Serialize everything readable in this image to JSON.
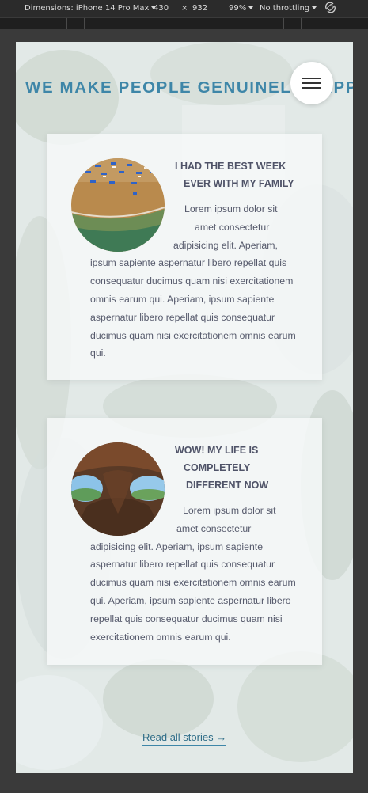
{
  "devtools": {
    "dimensions_label": "Dimensions: iPhone 14 Pro Max",
    "width": "430",
    "times": "×",
    "height": "932",
    "zoom": "99%",
    "throttling": "No throttling",
    "rotate_icon": "rotate-icon"
  },
  "page": {
    "headline": "WE MAKE PEOPLE GENUINELY HAPPY",
    "menu_icon": "hamburger-menu-icon"
  },
  "stories": [
    {
      "title_lines": [
        "I HAD THE BEST WEEK",
        "EVER WITH MY FAMILY"
      ],
      "body_lines": [
        "Lorem ipsum dolor sit",
        "amet consectetur",
        "adipisicing elit. Aperiam,",
        "ipsum sapiente aspernatur libero repellat quis",
        "consequatur ducimus quam nisi exercitationem",
        "omnis earum qui. Aperiam, ipsum sapiente",
        "aspernatur libero repellat quis consequatur",
        "ducimus quam nisi exercitationem omnis earum",
        "qui."
      ],
      "image": "beach-aerial-photo"
    },
    {
      "title_lines": [
        "WOW! MY LIFE IS",
        "COMPLETELY",
        "DIFFERENT NOW"
      ],
      "body_lines": [
        "Lorem ipsum dolor sit",
        "amet consectetur",
        "adipisicing elit. Aperiam, ipsum sapiente",
        "aspernatur libero repellat quis consequatur",
        "ducimus quam nisi exercitationem omnis earum",
        "qui. Aperiam, ipsum sapiente aspernatur libero",
        "repellat quis consequatur ducimus quam nisi",
        "exercitationem omnis earum qui."
      ],
      "image": "cave-rock-photo"
    }
  ],
  "read_all": "Read all stories →"
}
